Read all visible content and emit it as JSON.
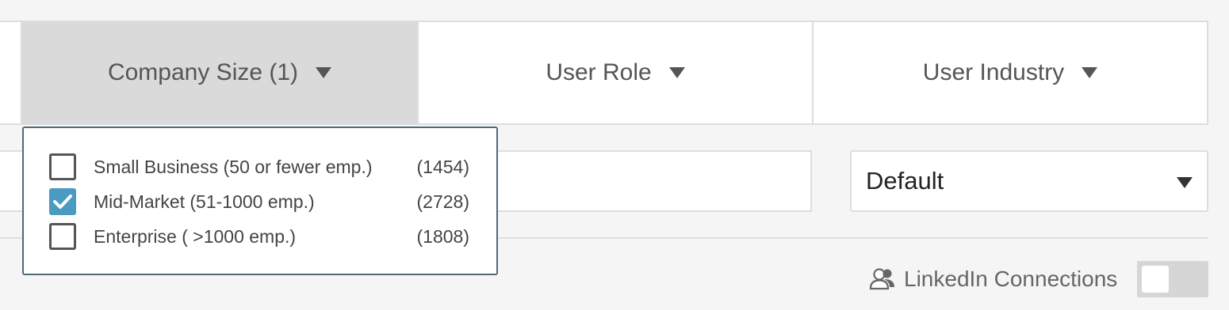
{
  "filters": {
    "tabs": [
      {
        "label": "Company Size (1)",
        "active": true
      },
      {
        "label": "User Role",
        "active": false
      },
      {
        "label": "User Industry",
        "active": false
      }
    ]
  },
  "company_size_dropdown": {
    "options": [
      {
        "label": "Small Business (50 or fewer emp.)",
        "count": "(1454)",
        "checked": false
      },
      {
        "label": "Mid-Market (51-1000 emp.)",
        "count": "(2728)",
        "checked": true
      },
      {
        "label": "Enterprise ( >1000 emp.)",
        "count": "(1808)",
        "checked": false
      }
    ]
  },
  "search": {
    "value": ""
  },
  "sort": {
    "selected": "Default"
  },
  "linkedin": {
    "label": "LinkedIn Connections",
    "enabled": false,
    "icon": "people-icon"
  },
  "colors": {
    "accent": "#4a9ac2",
    "active_tab": "#dadada",
    "dropdown_border": "#4e6a78",
    "toggle_off": "#d6d6d6"
  }
}
